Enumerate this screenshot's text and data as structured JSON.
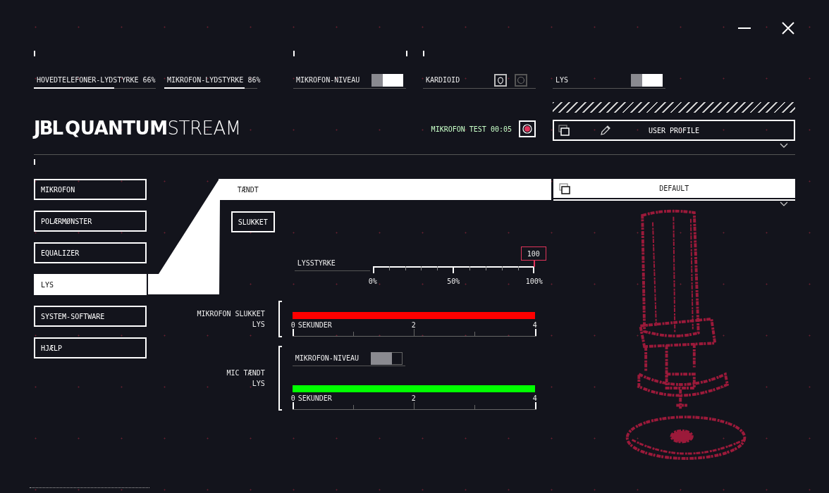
{
  "top_controls": [
    {
      "kind": "slider",
      "label": "HOVEDTELEFONER-LYDSTYRKE 66%",
      "level": 0.66
    },
    {
      "kind": "slider",
      "label": "MIKROFON-LYDSTYRKE 86%",
      "level": 0.86
    },
    {
      "kind": "toggle",
      "label": "MIKROFON-NIVEAU",
      "on": true
    },
    {
      "kind": "pattern",
      "label": "KARDIOID",
      "options": [
        {
          "selected": true
        },
        {
          "selected": false
        }
      ]
    },
    {
      "kind": "toggle",
      "label": "LYS",
      "on": true
    }
  ],
  "brand": [
    "JBL",
    "QUANTUM",
    "STREAM"
  ],
  "mic_test": {
    "label": "MIKROFON TEST 00:05",
    "recording": true
  },
  "user_profile": {
    "label": "USER PROFILE"
  },
  "sidebar": [
    {
      "label": "MIKROFON",
      "selected": false
    },
    {
      "label": "POLÆRMØNSTER",
      "selected": false
    },
    {
      "label": "EQUALIZER",
      "selected": false
    },
    {
      "label": "LYS",
      "selected": true
    },
    {
      "label": "SYSTEM-SOFTWARE",
      "selected": false
    },
    {
      "label": "HJÆLP",
      "selected": false
    }
  ],
  "light_mode": [
    {
      "label": "TÆNDT",
      "selected": true
    },
    {
      "label": "SLUKKET",
      "selected": false
    }
  ],
  "brightness": {
    "label": "LYSSTYRKE",
    "level": 1.0,
    "value": "100",
    "ticks": [
      "0%",
      "50%",
      "100%"
    ]
  },
  "sections": [
    {
      "label": "MIKROFON SLUKKET\nLYS",
      "color": "#ff0000",
      "axis_start": "0",
      "unit": "SEKUNDER",
      "ticks": [
        "2",
        "4"
      ]
    },
    {
      "label": "MIC TÆNDT\nLYS",
      "toggle": {
        "label": "MIKROFON-NIVEAU",
        "on": false
      },
      "color": "#00ff00",
      "axis_start": "0",
      "unit": "SEKUNDER",
      "ticks": [
        "2",
        "4"
      ]
    }
  ],
  "profile": {
    "label": "DEFAULT"
  }
}
